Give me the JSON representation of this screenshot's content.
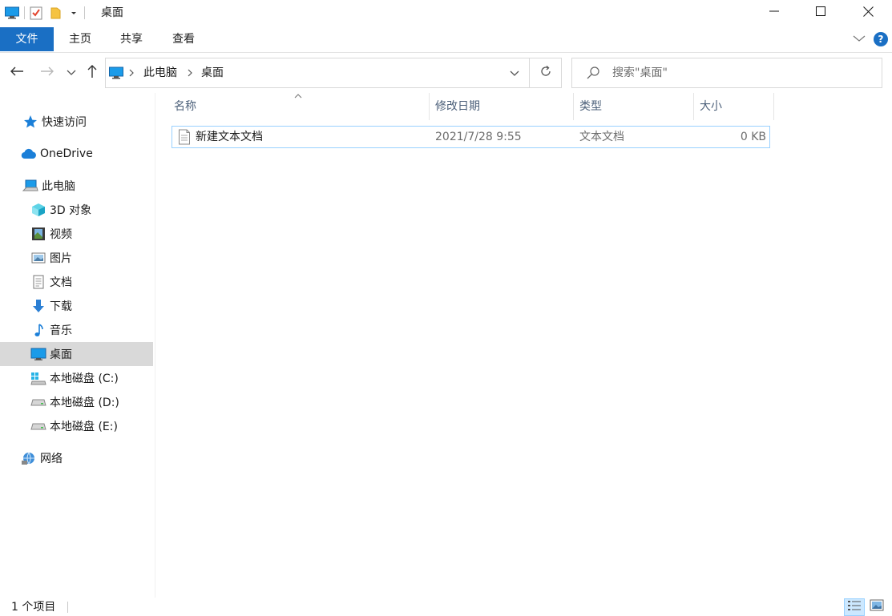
{
  "window": {
    "title": "桌面",
    "minimize_icon": "minimize-icon",
    "maximize_icon": "maximize-icon",
    "close_icon": "close-icon"
  },
  "quick_access_toolbar": {
    "icons": [
      "desktop-icon",
      "properties-icon",
      "new-folder-icon",
      "customize-dropdown-icon"
    ]
  },
  "ribbon": {
    "tabs": [
      {
        "label": "文件"
      },
      {
        "label": "主页"
      },
      {
        "label": "共享"
      },
      {
        "label": "查看"
      }
    ],
    "expand_icon": "chevron-down-icon",
    "help_label": "?",
    "accent_color": "#1a6fc4"
  },
  "address": {
    "segments": [
      "此电脑",
      "桌面"
    ]
  },
  "search": {
    "placeholder": "搜索\"桌面\""
  },
  "sidebar": {
    "items": [
      {
        "label": "快速访问",
        "icon": "star-icon"
      },
      {
        "label": "OneDrive",
        "icon": "cloud-icon"
      },
      {
        "label": "此电脑",
        "icon": "computer-icon"
      },
      {
        "label": "3D 对象",
        "icon": "cube-icon"
      },
      {
        "label": "视频",
        "icon": "film-icon"
      },
      {
        "label": "图片",
        "icon": "picture-icon"
      },
      {
        "label": "文档",
        "icon": "document-icon"
      },
      {
        "label": "下载",
        "icon": "download-arrow-icon"
      },
      {
        "label": "音乐",
        "icon": "music-note-icon"
      },
      {
        "label": "桌面",
        "icon": "desktop-icon",
        "selected": true
      },
      {
        "label": "本地磁盘 (C:)",
        "icon": "windows-drive-icon"
      },
      {
        "label": "本地磁盘 (D:)",
        "icon": "drive-icon"
      },
      {
        "label": "本地磁盘 (E:)",
        "icon": "drive-icon"
      },
      {
        "label": "网络",
        "icon": "network-icon"
      }
    ]
  },
  "columns": {
    "name": "名称",
    "date": "修改日期",
    "type": "类型",
    "size": "大小"
  },
  "files": [
    {
      "name": "新建文本文档",
      "date": "2021/7/28 9:55",
      "type": "文本文档",
      "size": "0 KB",
      "icon": "text-file-icon"
    }
  ],
  "status": {
    "item_count": "1 个项目"
  }
}
